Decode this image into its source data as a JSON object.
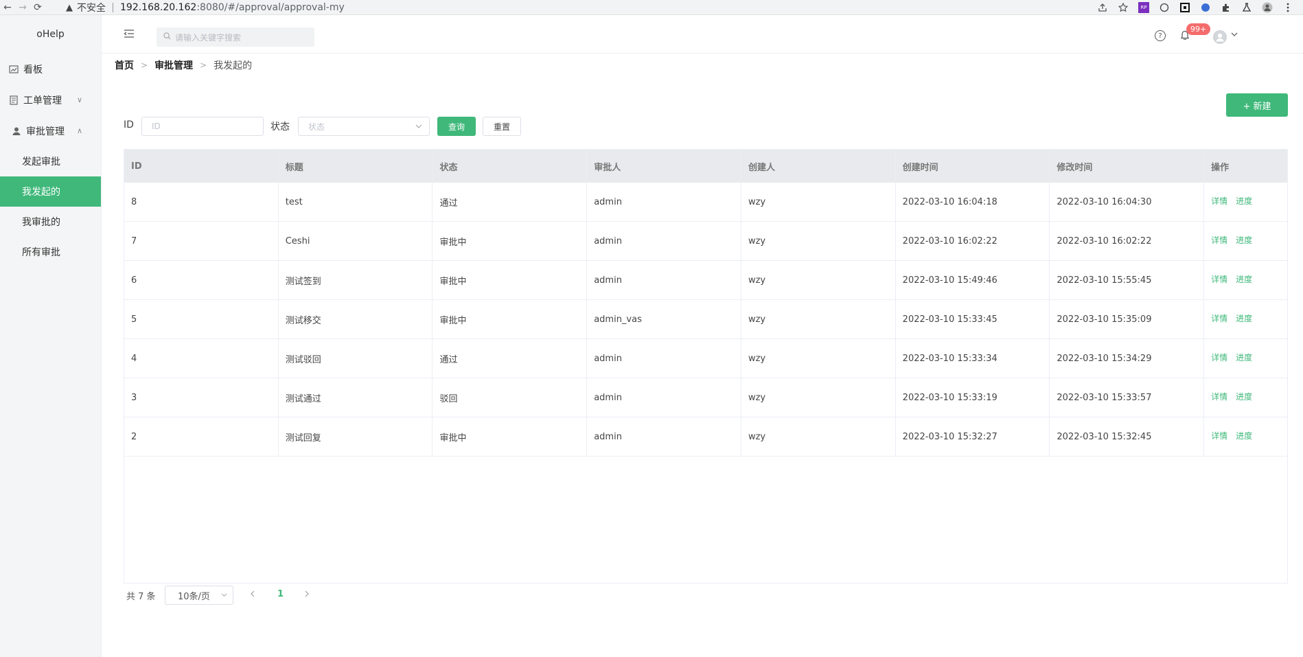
{
  "browser": {
    "back_glyph": "←",
    "forward_glyph": "→",
    "reload_glyph": "⟳",
    "warn_glyph": "▲",
    "insecure_label": "不安全",
    "host": "192.168.20.162",
    "path": ":8080/#/approval/approval-my",
    "ext_icons": [
      "share-icon",
      "star-icon",
      "rp-icon",
      "extension-icon",
      "qr-icon",
      "translate-icon",
      "puzzle-icon",
      "flask-icon",
      "profile-icon",
      "more-icon"
    ]
  },
  "sidebar": {
    "logo": "oHelp",
    "menu": [
      {
        "label": "看板",
        "icon": "dashboard-icon"
      },
      {
        "label": "工单管理",
        "icon": "ticket-icon",
        "chevron": "∨"
      },
      {
        "label": "审批管理",
        "icon": "user-icon",
        "chevron": "∧"
      }
    ],
    "sub": [
      {
        "label": "发起审批"
      },
      {
        "label": "我发起的",
        "active": true
      },
      {
        "label": "我审批的"
      },
      {
        "label": "所有审批"
      }
    ]
  },
  "header": {
    "search_placeholder": "请输入关键字搜索",
    "badge": "99+"
  },
  "breadcrumb": {
    "home": "首页",
    "parent": "审批管理",
    "current": "我发起的",
    "sep": ">"
  },
  "filters": {
    "new_label": "+ 新建",
    "id_label": "ID",
    "id_placeholder": "ID",
    "status_label": "状态",
    "status_placeholder": "状态",
    "query_label": "查询",
    "reset_label": "重置"
  },
  "table": {
    "headers": [
      "ID",
      "标题",
      "状态",
      "审批人",
      "创建人",
      "创建时间",
      "修改时间",
      "操作"
    ],
    "op_detail": "详情",
    "op_progress": "进度",
    "rows": [
      [
        "8",
        "test",
        "通过",
        "admin",
        "wzy",
        "2022-03-10 16:04:18",
        "2022-03-10 16:04:30"
      ],
      [
        "7",
        "Ceshi",
        "审批中",
        "admin",
        "wzy",
        "2022-03-10 16:02:22",
        "2022-03-10 16:02:22"
      ],
      [
        "6",
        "测试签到",
        "审批中",
        "admin",
        "wzy",
        "2022-03-10 15:49:46",
        "2022-03-10 15:55:45"
      ],
      [
        "5",
        "测试移交",
        "审批中",
        "admin_vas",
        "wzy",
        "2022-03-10 15:33:45",
        "2022-03-10 15:35:09"
      ],
      [
        "4",
        "测试驳回",
        "通过",
        "admin",
        "wzy",
        "2022-03-10 15:33:34",
        "2022-03-10 15:34:29"
      ],
      [
        "3",
        "测试通过",
        "驳回",
        "admin",
        "wzy",
        "2022-03-10 15:33:19",
        "2022-03-10 15:33:57"
      ],
      [
        "2",
        "测试回复",
        "审批中",
        "admin",
        "wzy",
        "2022-03-10 15:32:27",
        "2022-03-10 15:32:45"
      ]
    ]
  },
  "pager": {
    "total": "共 7 条",
    "page_size": "10条/页",
    "current_page": "1"
  },
  "colors": {
    "accent": "#3fb87a",
    "badge": "#f56c6c"
  }
}
